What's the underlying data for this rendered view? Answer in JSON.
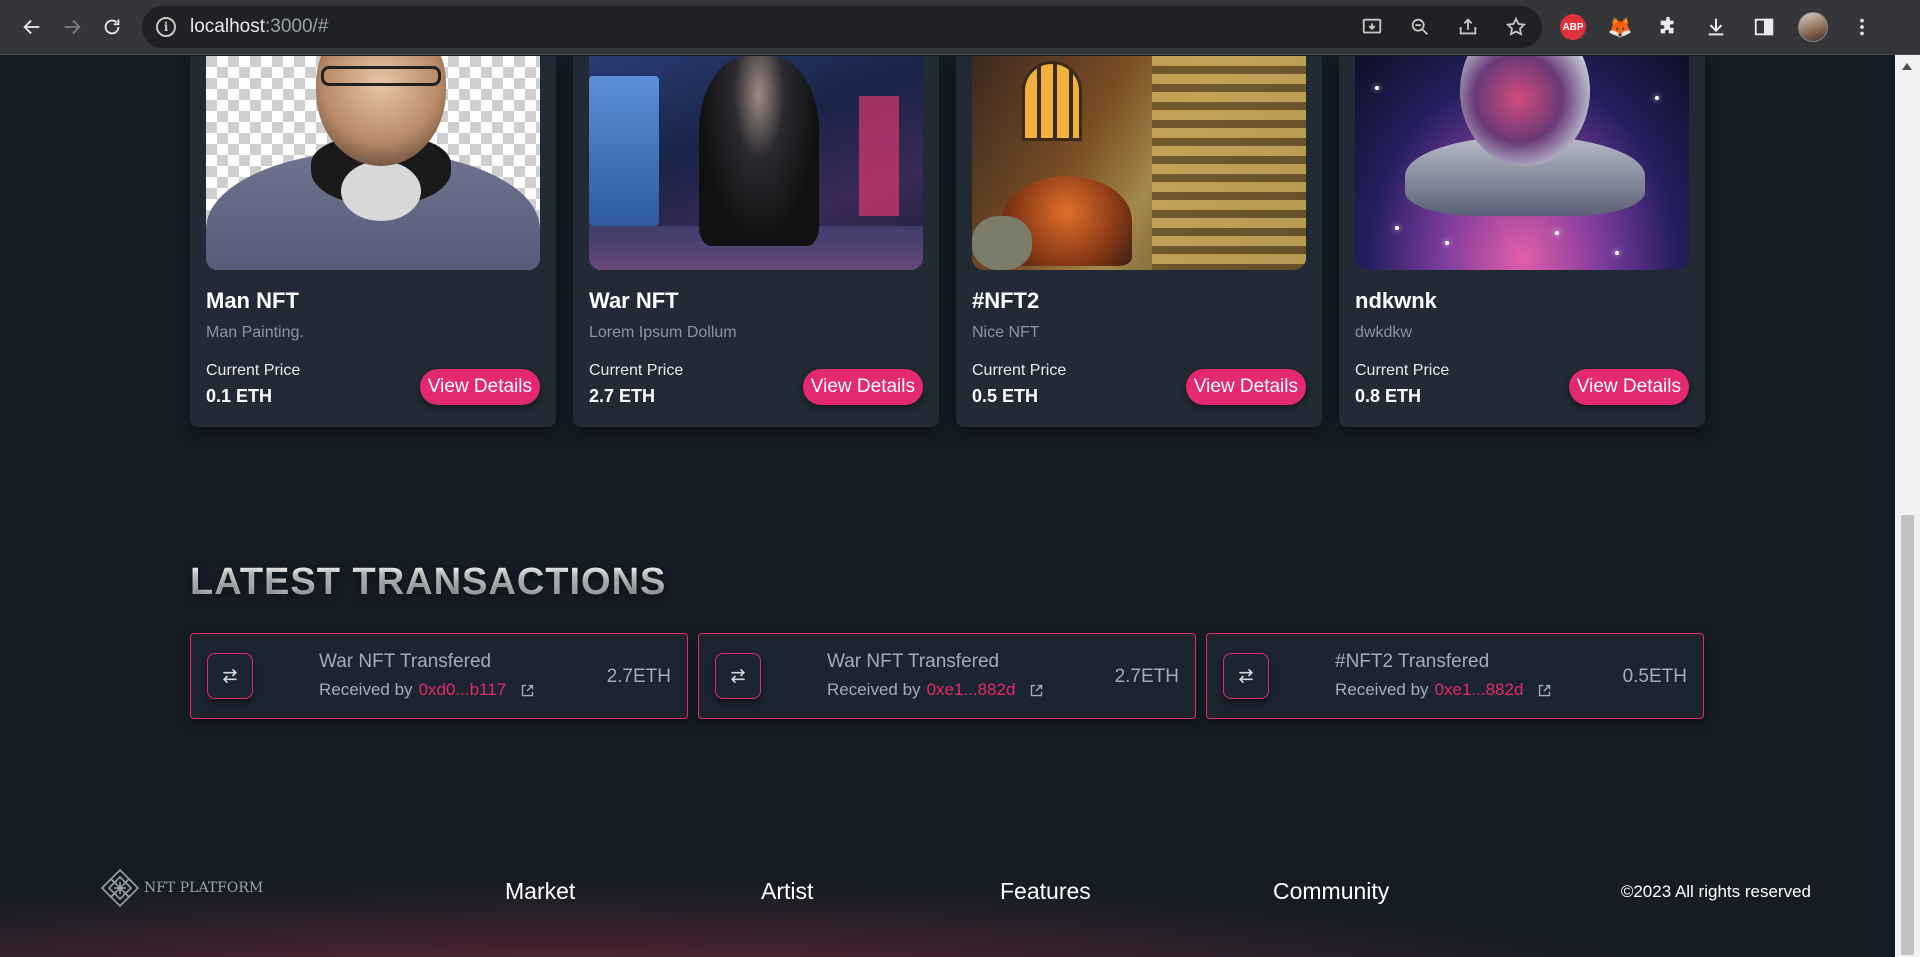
{
  "browser": {
    "url_host": "localhost",
    "url_rest": ":3000/#",
    "extensions": [
      "abp-icon",
      "metamask-fox-icon",
      "puzzle-extensions-icon",
      "download-icon",
      "side-panel-icon",
      "profile-avatar",
      "more-menu-icon"
    ],
    "abp_label": "ABP"
  },
  "nfts": [
    {
      "title": "Man NFT",
      "description": "Man Painting.",
      "price_label": "Current Price",
      "price": "0.1 ETH",
      "button": "View Details"
    },
    {
      "title": "War NFT",
      "description": "Lorem Ipsum Dollum",
      "price_label": "Current Price",
      "price": "2.7 ETH",
      "button": "View Details"
    },
    {
      "title": "#NFT2",
      "description": "Nice NFT",
      "price_label": "Current Price",
      "price": "0.5 ETH",
      "button": "View Details"
    },
    {
      "title": "ndkwnk",
      "description": "dwkdkw",
      "price_label": "Current Price",
      "price": "0.8 ETH",
      "button": "View Details"
    }
  ],
  "transactions": {
    "heading": "LATEST TRANSACTIONS",
    "items": [
      {
        "title": "War NFT Transfered",
        "received_by": "Received by",
        "address": "0xd0...b117",
        "amount": "2.7ETH"
      },
      {
        "title": "War NFT Transfered",
        "received_by": "Received by",
        "address": "0xe1...882d",
        "amount": "2.7ETH"
      },
      {
        "title": "#NFT2 Transfered",
        "received_by": "Received by",
        "address": "0xe1...882d",
        "amount": "0.5ETH"
      }
    ]
  },
  "footer": {
    "logo_text": "NFT PLATFORM",
    "links": [
      "Market",
      "Artist",
      "Features",
      "Community"
    ],
    "copyright": "©2023 All rights reserved"
  },
  "colors": {
    "accent": "#e32970",
    "background": "#151c25",
    "card": "#222a36"
  }
}
